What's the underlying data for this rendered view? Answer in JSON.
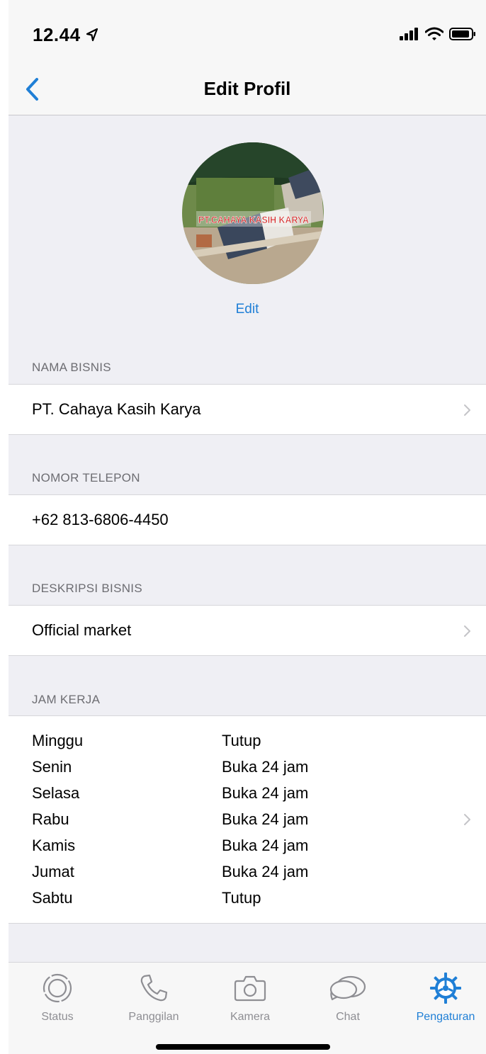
{
  "status_bar": {
    "time": "12.44"
  },
  "nav": {
    "title": "Edit Profil"
  },
  "profile": {
    "edit_label": "Edit",
    "photo_caption": "PT.CAHAYA KASIH KARYA"
  },
  "business_name": {
    "label": "NAMA BISNIS",
    "value": "PT. Cahaya Kasih Karya"
  },
  "phone": {
    "label": "NOMOR TELEPON",
    "value": "+62 813-6806-4450"
  },
  "description": {
    "label": "DESKRIPSI BISNIS",
    "value": "Official market"
  },
  "hours": {
    "label": "JAM KERJA",
    "days": [
      {
        "day": "Minggu",
        "time": "Tutup"
      },
      {
        "day": "Senin",
        "time": "Buka 24 jam"
      },
      {
        "day": "Selasa",
        "time": "Buka 24 jam"
      },
      {
        "day": "Rabu",
        "time": "Buka 24 jam"
      },
      {
        "day": "Kamis",
        "time": "Buka 24 jam"
      },
      {
        "day": "Jumat",
        "time": "Buka 24 jam"
      },
      {
        "day": "Sabtu",
        "time": "Tutup"
      }
    ]
  },
  "tabs": [
    {
      "label": "Status",
      "icon": "status-icon"
    },
    {
      "label": "Panggilan",
      "icon": "phone-icon"
    },
    {
      "label": "Kamera",
      "icon": "camera-icon"
    },
    {
      "label": "Chat",
      "icon": "chat-icon"
    },
    {
      "label": "Pengaturan",
      "icon": "settings-icon",
      "active": true
    }
  ],
  "colors": {
    "accent": "#1f7fd6",
    "background": "#efeff4",
    "muted": "#8e8e93"
  }
}
